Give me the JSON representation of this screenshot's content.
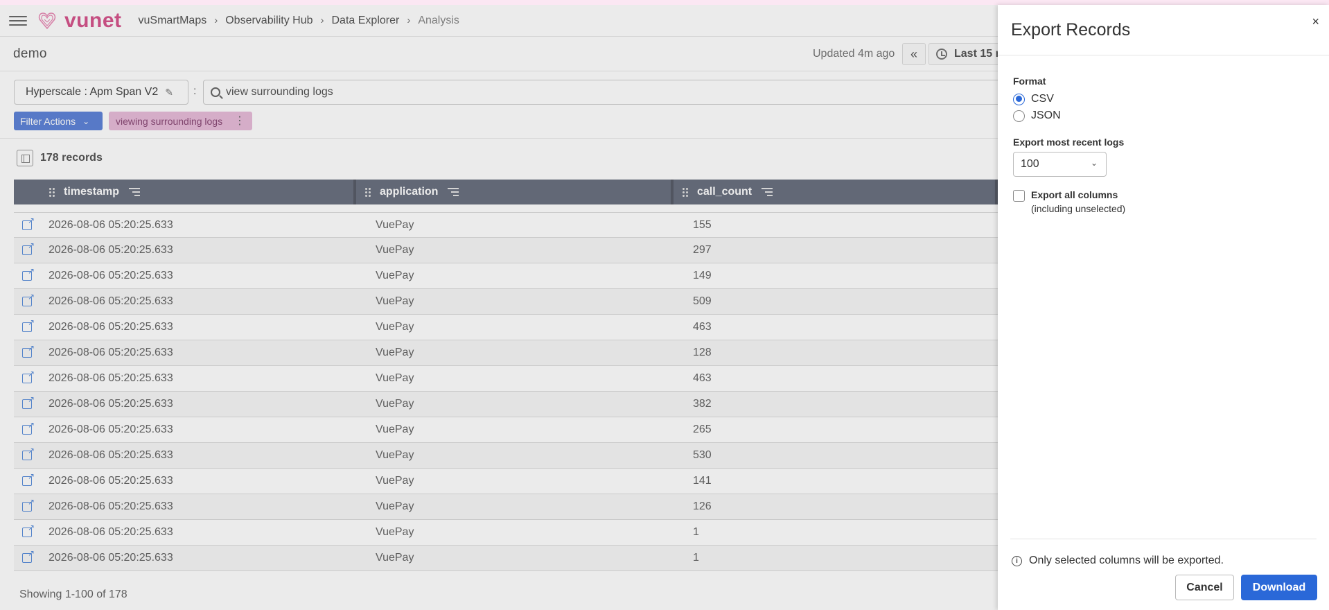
{
  "app": {
    "brand": "vunet",
    "brand_color": "#d6558d",
    "accent_color": "#2a68d8"
  },
  "breadcrumb": [
    "vuSmartMaps",
    "Observability Hub",
    "Data Explorer",
    "Analysis"
  ],
  "page": {
    "title": "demo",
    "updated": "Updated 4m ago",
    "time_range": "Last 15 r"
  },
  "query": {
    "index": "Hyperscale : Apm Span V2",
    "separator": ":",
    "search_value": "view surrounding logs"
  },
  "filters": {
    "actions_label": "Filter Actions",
    "chip_label": "viewing surrounding logs"
  },
  "records": {
    "count_label": "178 records",
    "footer": "Showing 1-100 of 178"
  },
  "table": {
    "columns": [
      "timestamp",
      "application",
      "call_count"
    ],
    "rows": [
      [
        "2026-08-06 05:20:25.633",
        "VuePay",
        "155"
      ],
      [
        "2026-08-06 05:20:25.633",
        "VuePay",
        "297"
      ],
      [
        "2026-08-06 05:20:25.633",
        "VuePay",
        "149"
      ],
      [
        "2026-08-06 05:20:25.633",
        "VuePay",
        "509"
      ],
      [
        "2026-08-06 05:20:25.633",
        "VuePay",
        "463"
      ],
      [
        "2026-08-06 05:20:25.633",
        "VuePay",
        "128"
      ],
      [
        "2026-08-06 05:20:25.633",
        "VuePay",
        "463"
      ],
      [
        "2026-08-06 05:20:25.633",
        "VuePay",
        "382"
      ],
      [
        "2026-08-06 05:20:25.633",
        "VuePay",
        "265"
      ],
      [
        "2026-08-06 05:20:25.633",
        "VuePay",
        "530"
      ],
      [
        "2026-08-06 05:20:25.633",
        "VuePay",
        "141"
      ],
      [
        "2026-08-06 05:20:25.633",
        "VuePay",
        "126"
      ],
      [
        "2026-08-06 05:20:25.633",
        "VuePay",
        "1"
      ],
      [
        "2026-08-06 05:20:25.633",
        "VuePay",
        "1"
      ]
    ]
  },
  "export": {
    "title": "Export Records",
    "close": "×",
    "format_label": "Format",
    "formats": [
      "CSV",
      "JSON"
    ],
    "selected_format": "CSV",
    "recent_label": "Export most recent logs",
    "recent_value": "100",
    "all_columns_label": "Export all columns",
    "all_columns_sub": "(including unselected)",
    "all_columns_checked": false,
    "note": "Only selected columns will be exported.",
    "cancel_label": "Cancel",
    "download_label": "Download"
  }
}
